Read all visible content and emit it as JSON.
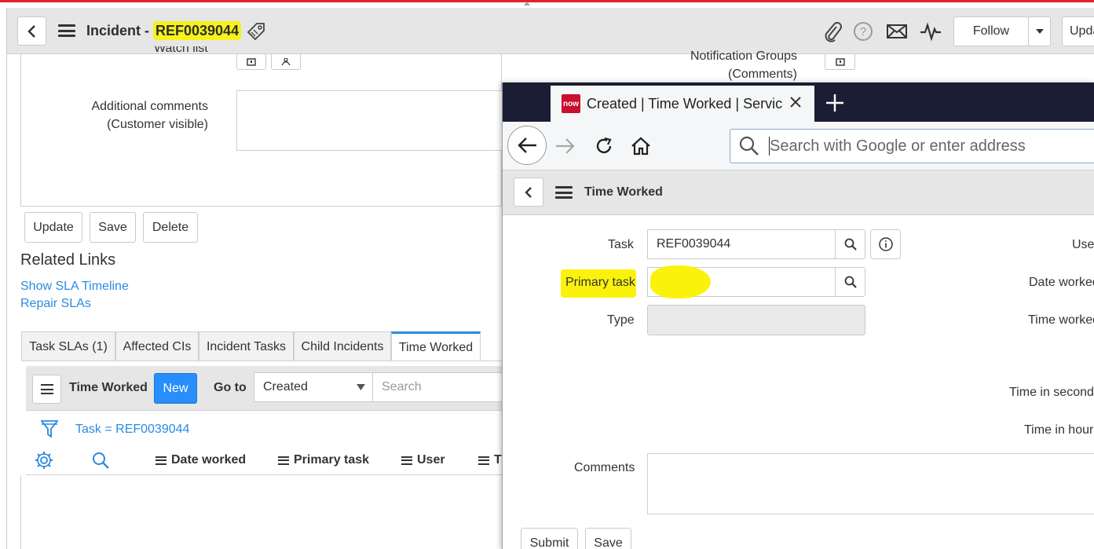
{
  "header": {
    "title_prefix": "Incident - ",
    "ref": "REF0039044",
    "follow_label": "Follow",
    "update_label": "Upda"
  },
  "form": {
    "watch_list_partial": "Watch list",
    "additional_comments_line1": "Additional comments",
    "additional_comments_line2": "(Customer visible)",
    "notification_groups_line1": "Notification Groups",
    "notification_groups_line2": "(Comments)",
    "buttons": {
      "update": "Update",
      "save": "Save",
      "delete": "Delete"
    }
  },
  "related_links": {
    "title": "Related Links",
    "links": [
      "Show SLA Timeline",
      "Repair SLAs"
    ]
  },
  "tabs": [
    "Task SLAs (1)",
    "Affected CIs",
    "Incident Tasks",
    "Child Incidents",
    "Time Worked"
  ],
  "list": {
    "title": "Time Worked",
    "new_label": "New",
    "goto_label": "Go to",
    "goto_select": "Created",
    "search_placeholder": "Search",
    "filter_text": "Task = REF0039044",
    "columns": [
      "Date worked",
      "Primary task",
      "User",
      "T"
    ]
  },
  "popup": {
    "tab_title": "Created | Time Worked | Service",
    "tab_icon_text": "now",
    "url_placeholder": "Search with Google or enter address",
    "form_title": "Time Worked",
    "fields": {
      "task_label": "Task",
      "task_value": "REF0039044",
      "primary_task_label": "Primary task",
      "type_label": "Type",
      "comments_label": "Comments",
      "user_label": "Use",
      "date_worked_label": "Date worked",
      "time_worked_label": "Time worked",
      "time_seconds_label": "Time in seconds",
      "time_hours_label": "Time in hours"
    },
    "buttons": {
      "submit": "Submit",
      "save": "Save"
    }
  }
}
